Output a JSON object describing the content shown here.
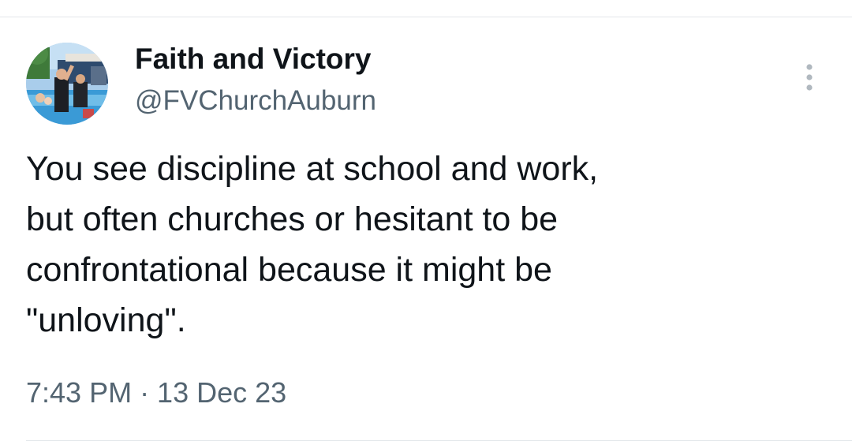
{
  "tweet": {
    "author": {
      "display_name": "Faith and Victory",
      "handle": "@FVChurchAuburn",
      "avatar_icon": "profile-photo"
    },
    "text": "You see discipline at school and work,\nbut often churches or hesitant to be\nconfrontational because it might be\n\"unloving\".",
    "timestamp": "7:43 PM · 13 Dec 23",
    "more_icon": "more-vertical-icon"
  },
  "colors": {
    "primary_text": "#0f1419",
    "secondary_text": "#536471",
    "divider": "#e3e7ea",
    "more_icon": "#b0b8bf"
  }
}
